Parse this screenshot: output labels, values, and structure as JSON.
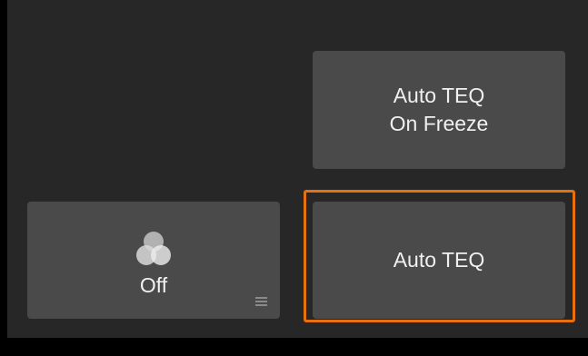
{
  "buttons": {
    "auto_teq_on_freeze": {
      "line1": "Auto TEQ",
      "line2": "On Freeze"
    },
    "auto_teq": {
      "label": "Auto TEQ"
    },
    "color_mode": {
      "label": "Off",
      "icon": "three-circles-icon"
    }
  },
  "colors": {
    "highlight": "#e8700e",
    "tile": "#4a4a4a",
    "panel": "#272727"
  }
}
